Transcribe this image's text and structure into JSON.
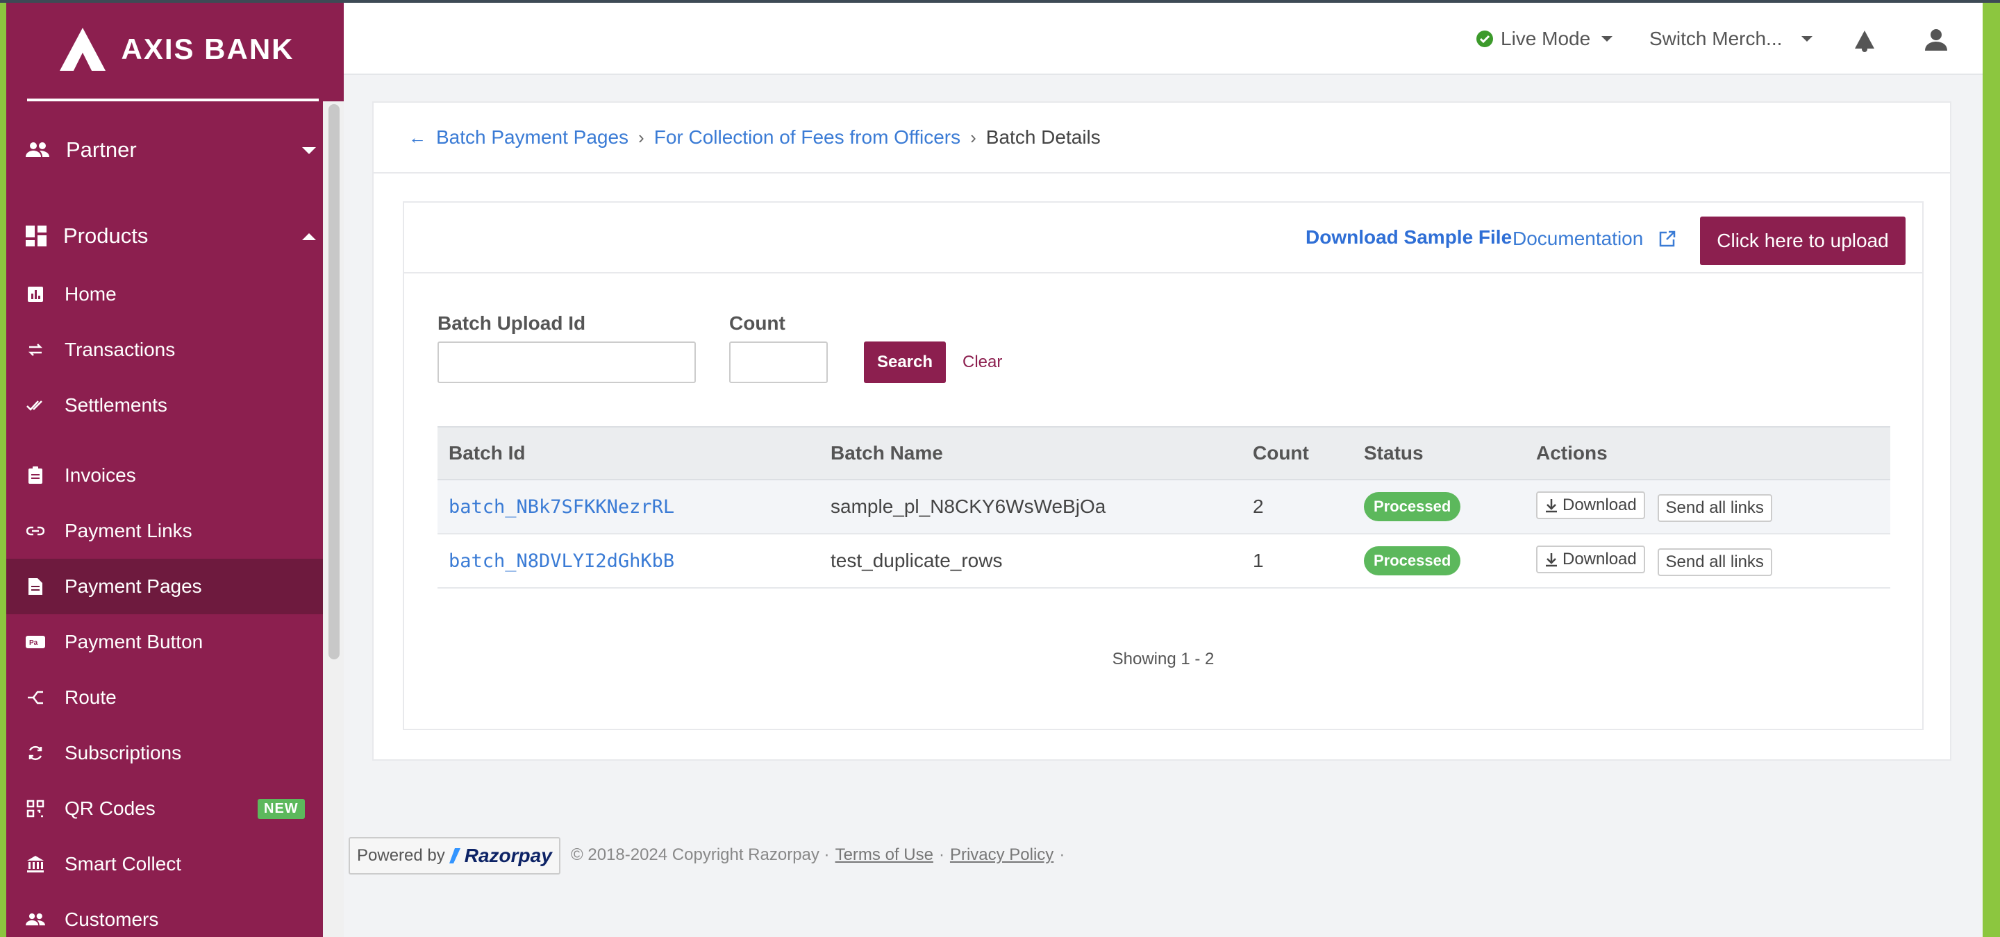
{
  "brand": {
    "name": "AXIS BANK"
  },
  "sidebar": {
    "groups": [
      {
        "label": "Partner",
        "icon": "people-icon"
      },
      {
        "label": "Products",
        "icon": "dashboard-icon"
      }
    ],
    "items": [
      {
        "label": "Home",
        "icon": "chart-icon"
      },
      {
        "label": "Transactions",
        "icon": "swap-icon"
      },
      {
        "label": "Settlements",
        "icon": "double-check-icon"
      },
      {
        "label": "Invoices",
        "icon": "clipboard-icon"
      },
      {
        "label": "Payment Links",
        "icon": "link-icon"
      },
      {
        "label": "Payment Pages",
        "icon": "document-icon",
        "active": true
      },
      {
        "label": "Payment Button",
        "icon": "button-icon"
      },
      {
        "label": "Route",
        "icon": "route-icon"
      },
      {
        "label": "Subscriptions",
        "icon": "refresh-icon"
      },
      {
        "label": "QR Codes",
        "icon": "qr-icon",
        "badge": "NEW"
      },
      {
        "label": "Smart Collect",
        "icon": "bank-icon"
      },
      {
        "label": "Customers",
        "icon": "people-icon"
      }
    ]
  },
  "topbar": {
    "mode": "Live Mode",
    "merchant": "Switch Merch...",
    "mode_color": "#3c9a2b"
  },
  "breadcrumb": {
    "items": [
      "Batch Payment Pages",
      "For Collection of Fees from Officers"
    ],
    "current": "Batch Details"
  },
  "actions": {
    "download_sample": "Download Sample File",
    "documentation": "Documentation",
    "upload": "Click here to upload"
  },
  "filters": {
    "batch_id_label": "Batch Upload Id",
    "batch_id_value": "",
    "count_label": "Count",
    "count_value": "",
    "search": "Search",
    "clear": "Clear"
  },
  "table": {
    "columns": [
      "Batch Id",
      "Batch Name",
      "Count",
      "Status",
      "Actions"
    ],
    "rows": [
      {
        "batch_id": "batch_NBk7SFKKNezrRL",
        "batch_name": "sample_pl_N8CKY6WsWeBjOa",
        "count": "2",
        "status": "Processed",
        "download": "Download",
        "send": "Send all links"
      },
      {
        "batch_id": "batch_N8DVLYI2dGhKbB",
        "batch_name": "test_duplicate_rows",
        "count": "1",
        "status": "Processed",
        "download": "Download",
        "send": "Send all links"
      }
    ]
  },
  "pagination": {
    "text": "Showing 1 - 2"
  },
  "footer": {
    "powered_by": "Powered by",
    "razorpay": "Razorpay",
    "copyright": "© 2018-2024 Copyright Razorpay ·",
    "terms": "Terms of Use",
    "dot1": "·",
    "privacy": "Privacy Policy",
    "dot2": "·"
  },
  "colors": {
    "brand": "#8c1f4f",
    "accent": "#3a7bd5",
    "success": "#5cb85c"
  }
}
